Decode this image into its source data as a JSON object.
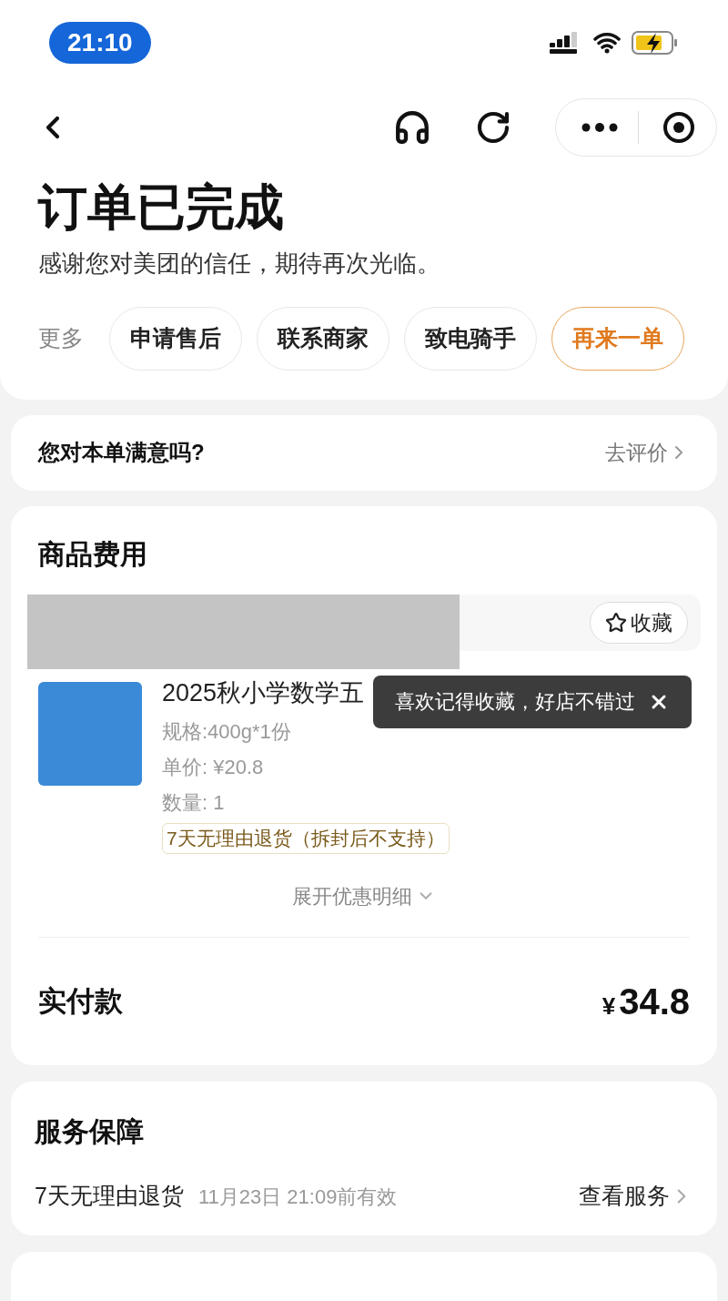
{
  "status_bar": {
    "time": "21:10"
  },
  "header": {
    "title": "订单已完成",
    "subtitle": "感谢您对美团的信任，期待再次光临。"
  },
  "actions": {
    "label": "更多",
    "buttons": [
      {
        "label": "申请售后",
        "kind": "default"
      },
      {
        "label": "联系商家",
        "kind": "default"
      },
      {
        "label": "致电骑手",
        "kind": "default"
      },
      {
        "label": "再来一单",
        "kind": "primary"
      }
    ]
  },
  "satisfaction": {
    "question": "您对本单满意吗?",
    "link": "去评价"
  },
  "goods": {
    "title": "商品费用",
    "favorite_button": "收藏",
    "product": {
      "title": "2025秋小学数学五",
      "spec": "规格:400g*1份",
      "unit_price": "单价: ¥20.8",
      "quantity": "数量: 1",
      "tag": "7天无理由退货（拆封后不支持）"
    },
    "tooltip": {
      "text": "喜欢记得收藏，好店不错过"
    },
    "expand": "展开优惠明细",
    "total_label": "实付款",
    "currency": "¥",
    "total_amount": "34.8"
  },
  "service": {
    "title": "服务保障",
    "items": [
      {
        "name": "7天无理由退货",
        "validity": "11月23日 21:09前有效",
        "link": "查看服务"
      }
    ]
  }
}
